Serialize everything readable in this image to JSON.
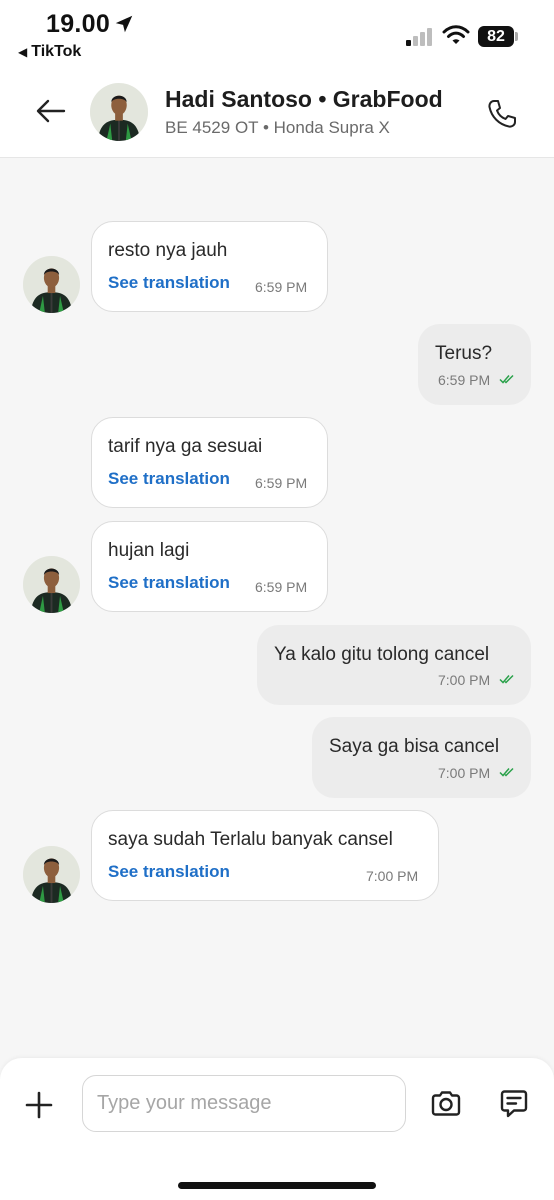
{
  "status_bar": {
    "time": "19.00",
    "back_app": "TikTok",
    "battery": "82"
  },
  "header": {
    "name": "Hadi Santoso • GrabFood",
    "subtitle": "BE 4529 OT • Honda Supra X"
  },
  "colors": {
    "link": "#1f6fc7",
    "read_tick": "#2aa14a",
    "outgoing_bubble": "#ececec",
    "incoming_border": "#dcdcdc"
  },
  "messages": [
    {
      "direction": "in",
      "text": "resto nya jauh",
      "translate_label": "See translation",
      "time": "6:59 PM"
    },
    {
      "direction": "out",
      "text": "Terus?",
      "time": "6:59 PM",
      "status": "read"
    },
    {
      "direction": "in",
      "text": "tarif nya ga sesuai",
      "translate_label": "See translation",
      "time": "6:59 PM"
    },
    {
      "direction": "in",
      "text": "hujan lagi",
      "translate_label": "See translation",
      "time": "6:59 PM"
    },
    {
      "direction": "out",
      "text": "Ya kalo gitu tolong cancel",
      "time": "7:00 PM",
      "status": "read"
    },
    {
      "direction": "out",
      "text": "Saya ga bisa cancel",
      "time": "7:00 PM",
      "status": "read"
    },
    {
      "direction": "in",
      "text": "saya sudah Terlalu banyak cansel",
      "translate_label": "See translation",
      "time": "7:00 PM"
    }
  ],
  "composer": {
    "placeholder": "Type your message",
    "icons": [
      "plus-icon",
      "camera-icon",
      "chat-bubble-icon"
    ]
  }
}
